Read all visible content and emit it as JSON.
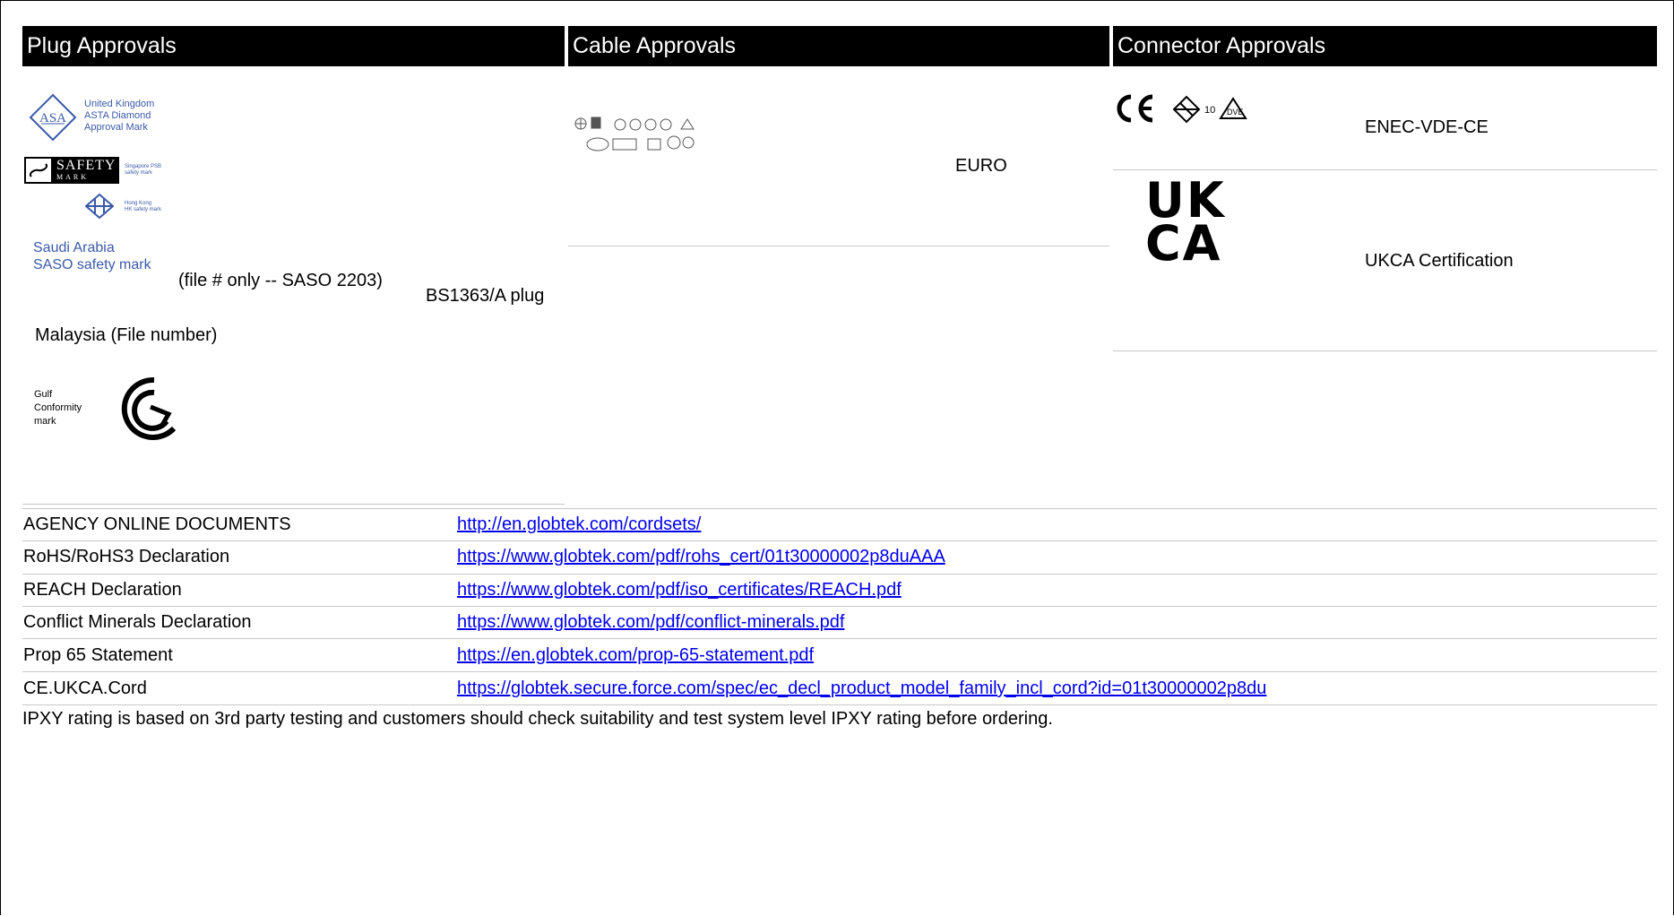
{
  "headers": {
    "plug": "Plug Approvals",
    "cable": "Cable Approvals",
    "connector": "Connector Approvals"
  },
  "plug": {
    "asta_line1": "United Kingdom",
    "asta_line2": "ASTA Diamond",
    "asta_line3": "Approval Mark",
    "asta_logo": "ASA",
    "safety_logo_line1": "SAFETY",
    "safety_logo_line2": "MARK",
    "singapore_line1": "Singapore PSB",
    "singapore_line2": "safety mark",
    "hk_line1": "Hong Kong",
    "hk_line2": "HK safety mark",
    "saudi_line1": "Saudi Arabia",
    "saudi_line2": "SASO safety mark",
    "saso_note": "(file # only -- SASO 2203)",
    "bs_plug": "BS1363/A plug",
    "malaysia": "Malaysia (File number)",
    "gulf_line1": "Gulf",
    "gulf_line2": "Conformity",
    "gulf_line3": "mark"
  },
  "cable": {
    "type": "EURO"
  },
  "connector": {
    "enec_label": "ENEC-VDE-CE",
    "ukca_logo_line1": "UK",
    "ukca_logo_line2": "CA",
    "ukca_label": "UKCA Certification"
  },
  "documents": [
    {
      "label": "AGENCY ONLINE DOCUMENTS",
      "url": "http://en.globtek.com/cordsets/"
    },
    {
      "label": "RoHS/RoHS3 Declaration",
      "url": "https://www.globtek.com/pdf/rohs_cert/01t30000002p8duAAA"
    },
    {
      "label": "REACH Declaration",
      "url": "https://www.globtek.com/pdf/iso_certificates/REACH.pdf"
    },
    {
      "label": "Conflict Minerals Declaration",
      "url": "https://www.globtek.com/pdf/conflict-minerals.pdf"
    },
    {
      "label": "Prop 65 Statement",
      "url": "https://en.globtek.com/prop-65-statement.pdf"
    },
    {
      "label": "CE.UKCA.Cord",
      "url": "https://globtek.secure.force.com/spec/ec_decl_product_model_family_incl_cord?id=01t30000002p8du"
    }
  ],
  "footnote": "IPXY rating is based on 3rd party testing and customers should check suitability and test system level IPXY rating before ordering."
}
